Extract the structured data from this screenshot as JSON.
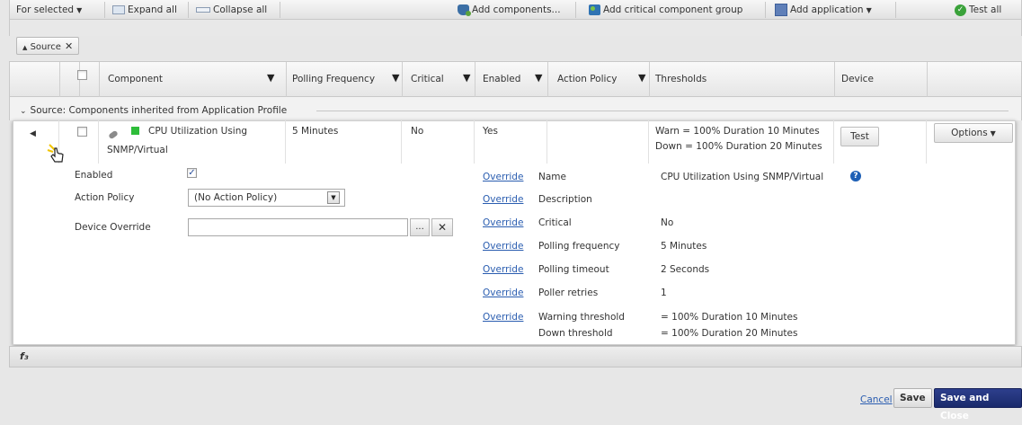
{
  "toolbar": {
    "for_selected": "For selected",
    "expand_all": "Expand all",
    "collapse_all": "Collapse all",
    "add_components": "Add components...",
    "add_critical_group": "Add critical component group",
    "add_application": "Add application",
    "test_all": "Test all"
  },
  "filter_chip": {
    "label": "Source",
    "close": "✕"
  },
  "columns": {
    "component": "Component",
    "polling_frequency": "Polling Frequency",
    "critical": "Critical",
    "enabled": "Enabled",
    "action_policy": "Action Policy",
    "thresholds": "Thresholds",
    "device": "Device"
  },
  "group": {
    "label": "Source: Components inherited from Application Profile"
  },
  "row": {
    "component_name": "CPU Utilization Using",
    "component_name_line2": "SNMP/Virtual",
    "polling_frequency": "5 Minutes",
    "critical": "No",
    "enabled": "Yes",
    "threshold_warn": "Warn = 100% Duration 10 Minutes",
    "threshold_down": "Down = 100% Duration 20 Minutes",
    "test_button": "Test",
    "options_button": "Options"
  },
  "details_left": {
    "enabled_label": "Enabled",
    "action_policy_label": "Action Policy",
    "action_policy_value": "(No Action Policy)",
    "device_override_label": "Device Override",
    "device_override_value": "",
    "browse_button": "...",
    "clear_button": "✕"
  },
  "details_right": {
    "override_link": "Override",
    "rows": [
      {
        "name": "Name",
        "value": "CPU Utilization Using SNMP/Virtual"
      },
      {
        "name": "Description",
        "value": ""
      },
      {
        "name": "Critical",
        "value": "No"
      },
      {
        "name": "Polling frequency",
        "value": "5 Minutes"
      },
      {
        "name": "Polling timeout",
        "value": "2 Seconds"
      },
      {
        "name": "Poller retries",
        "value": "1"
      },
      {
        "name": "Warning threshold",
        "value": "= 100% Duration 10 Minutes"
      }
    ],
    "down_threshold_label": "Down threshold",
    "down_threshold_value": "= 100% Duration 20 Minutes"
  },
  "footer": {
    "icon": "f₃"
  },
  "actions": {
    "cancel": "Cancel",
    "save": "Save",
    "save_and_close": "Save and Close"
  }
}
